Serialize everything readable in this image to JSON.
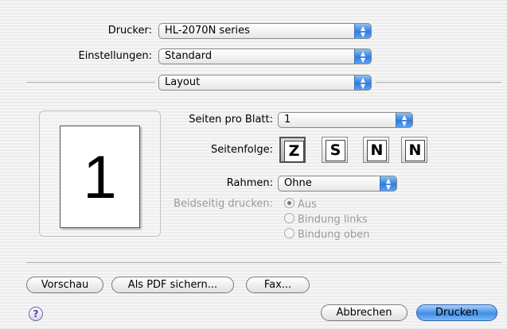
{
  "printer": {
    "label": "Drucker:",
    "value": "HL-2070N series"
  },
  "presets": {
    "label": "Einstellungen:",
    "value": "Standard"
  },
  "panel": {
    "value": "Layout"
  },
  "preview": {
    "page_number": "1"
  },
  "pages_per_sheet": {
    "label": "Seiten pro Blatt:",
    "value": "1"
  },
  "layout_direction": {
    "label": "Seitenfolge:",
    "options": [
      "Z",
      "S",
      "N",
      "N"
    ],
    "selected": 0
  },
  "border": {
    "label": "Rahmen:",
    "value": "Ohne"
  },
  "two_sided": {
    "label": "Beidseitig drucken:",
    "options": [
      "Aus",
      "Bindung links",
      "Bindung oben"
    ],
    "selected": "Aus"
  },
  "buttons": {
    "preview": "Vorschau",
    "save_pdf": "Als PDF sichern...",
    "fax": "Fax...",
    "cancel": "Abbrechen",
    "print": "Drucken",
    "help": "?"
  }
}
